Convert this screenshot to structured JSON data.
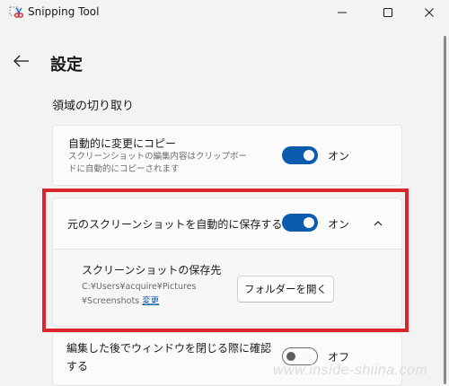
{
  "window": {
    "title": "Snipping Tool",
    "controls": [
      "minimize",
      "maximize",
      "close"
    ]
  },
  "header": {
    "back_icon": "back-arrow-icon",
    "title": "設定"
  },
  "section": {
    "title": "領域の切り取り"
  },
  "auto_copy": {
    "label": "自動的に変更にコピー",
    "description_line1": "スクリーンショットの編集内容はクリップボー",
    "description_line2": "ドに自動的にコピーされます",
    "toggle_state": "on",
    "toggle_label": "オン"
  },
  "auto_save": {
    "label": "元のスクリーンショットを自動的に保存する",
    "toggle_state": "on",
    "toggle_label": "オン",
    "expanded": true
  },
  "save_location": {
    "label": "スクリーンショットの保存先",
    "path_line1": "C:¥Users¥acquire¥Pictures",
    "path_line2": "¥Screenshots",
    "change_link": "変更",
    "open_folder_button": "フォルダーを開く"
  },
  "confirm_close": {
    "label_line1": "編集した後でウィンドウを閉じる際に確認",
    "label_line2": "する",
    "toggle_state": "off",
    "toggle_label": "オフ"
  },
  "watermark": "www.inside-shiina.com",
  "colors": {
    "accent": "#0b5cad",
    "highlight": "#d9252c",
    "background": "#f3f3f3"
  }
}
